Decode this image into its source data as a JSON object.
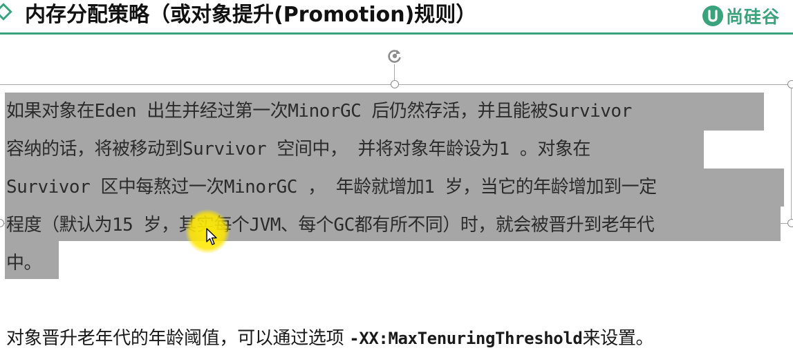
{
  "header": {
    "title": "内存分配策略（或对象提升(Promotion)规则）",
    "logo_text": "尚硅谷",
    "accent_color": "#3aa37d"
  },
  "slide": {
    "paragraph_lines": [
      "如果对象在Eden 出生并经过第一次MinorGC 后仍然存活，并且能被Survivor",
      "容纳的话，将被移动到Survivor 空间中， 并将对象年龄设为1 。对象在",
      "Survivor 区中每熬过一次MinorGC ， 年龄就增加1 岁，当它的年龄增加到一定",
      "程度（默认为15 岁，其实每个JVM、每个GC都有所不同）时，就会被晋升到老年代",
      "中。"
    ],
    "selection_color": "#a6a6a6",
    "threshold_sentence": {
      "prefix": "对象晋升老年代的年龄阈值，可以通过选项 ",
      "option": "-XX:MaxTenuringThreshold",
      "suffix": "来设置。"
    }
  },
  "icons": {
    "title_bullet": "diamond-bullet-icon",
    "logo_mark": "brand-logo-icon",
    "rotate_handle": "rotate-handle-icon",
    "cursor": "mouse-pointer-icon"
  }
}
